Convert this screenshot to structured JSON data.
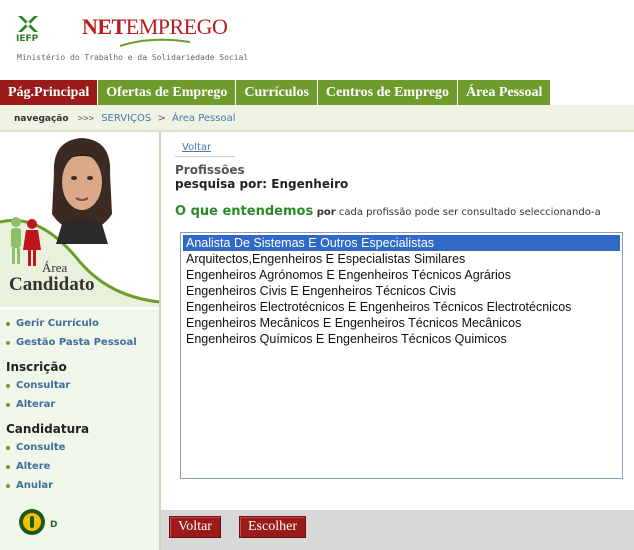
{
  "header": {
    "iefp_label": "IEFP",
    "brand_net": "NET",
    "brand_emprego": "EMPREGO",
    "ministry": "Ministério do Trabalho e da Solidariedade Social"
  },
  "nav": {
    "items": [
      {
        "label": "Pág.Principal",
        "active": true
      },
      {
        "label": "Ofertas de Emprego",
        "active": false
      },
      {
        "label": "Currículos",
        "active": false
      },
      {
        "label": "Centros de Emprego",
        "active": false
      },
      {
        "label": "Área Pessoal",
        "active": false
      }
    ]
  },
  "breadcrumb": {
    "label": "navegação",
    "arrows": ">>>",
    "link": "SERVIÇOS",
    "separator": ">",
    "current": "Área Pessoal"
  },
  "sidebar": {
    "area_label": "Área",
    "candidato_label": "Candidato",
    "links_top": [
      "Gerir Currículo",
      "Gestão Pasta Pessoal"
    ],
    "inscricao_heading": "Inscrição",
    "inscricao_links": [
      "Consultar",
      "Alterar"
    ],
    "candidatura_heading": "Candidatura",
    "candidatura_links": [
      "Consulte",
      "Altere",
      "Anular"
    ],
    "help_letter": "D"
  },
  "main": {
    "back_link": "Voltar",
    "section_title": "Profissões",
    "search_by": "pesquisa por: Engenheiro",
    "intro_title": "O que entendemos",
    "intro_por": "por",
    "intro_text": "cada profissão pode ser consultado seleccionando-a",
    "professions": [
      "Analista De Sistemas E Outros Especialistas",
      "Arquitectos,Engenheiros E Especialistas Similares",
      "Engenheiros Agrónomos E Engenheiros Técnicos Agrários",
      "Engenheiros Civis E Engenheiros Técnicos Civis",
      "Engenheiros Electrotécnicos E Engenheiros Técnicos Electrotécnicos",
      "Engenheiros Mecânicos E Engenheiros Técnicos Mecânicos",
      "Engenheiros Químicos E Engenheiros Técnicos Quimicos"
    ],
    "selected_index": 0,
    "buttons": {
      "voltar": "Voltar",
      "escolher": "Escolher"
    }
  },
  "colors": {
    "nav_green": "#6d9c2c",
    "nav_active": "#9b1b1b",
    "selection": "#3169c6",
    "intro_green": "#2a8a2a",
    "link_blue": "#4a78a8"
  }
}
